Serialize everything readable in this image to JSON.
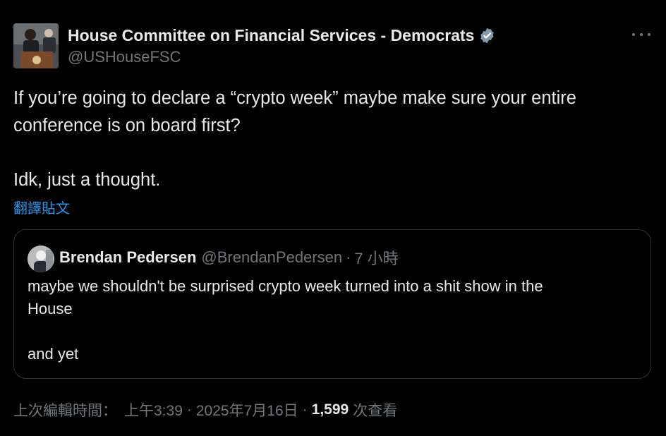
{
  "tweet": {
    "author": {
      "display_name": "House Committee on Financial Services - Democrats",
      "handle": "@USHouseFSC",
      "verified": true,
      "verified_color": "#829aab"
    },
    "more_icon": "ellipsis-icon",
    "text": "If you’re going to declare a “crypto week” maybe make sure your entire\nconference is on board first?\n\nIdk, just a thought.",
    "translate_label": "翻譯貼文",
    "quote": {
      "author_name": "Brendan Pedersen",
      "author_handle": "@BrendanPedersen",
      "separator": "·",
      "time": "7 小時",
      "text": "maybe we shouldn't be surprised crypto week turned into a shit show in the\nHouse\n\nand yet"
    },
    "meta": {
      "edited_label": "上次編輯時間：",
      "time": "上午3:39",
      "date": "2025年7月16日",
      "separator": "·",
      "views_count": "1,599",
      "views_label": "次查看"
    }
  },
  "colors": {
    "background": "#000000",
    "text_primary": "#e7e9ea",
    "text_secondary": "#71767b",
    "link": "#1d9bf0",
    "border": "#2f3336"
  }
}
